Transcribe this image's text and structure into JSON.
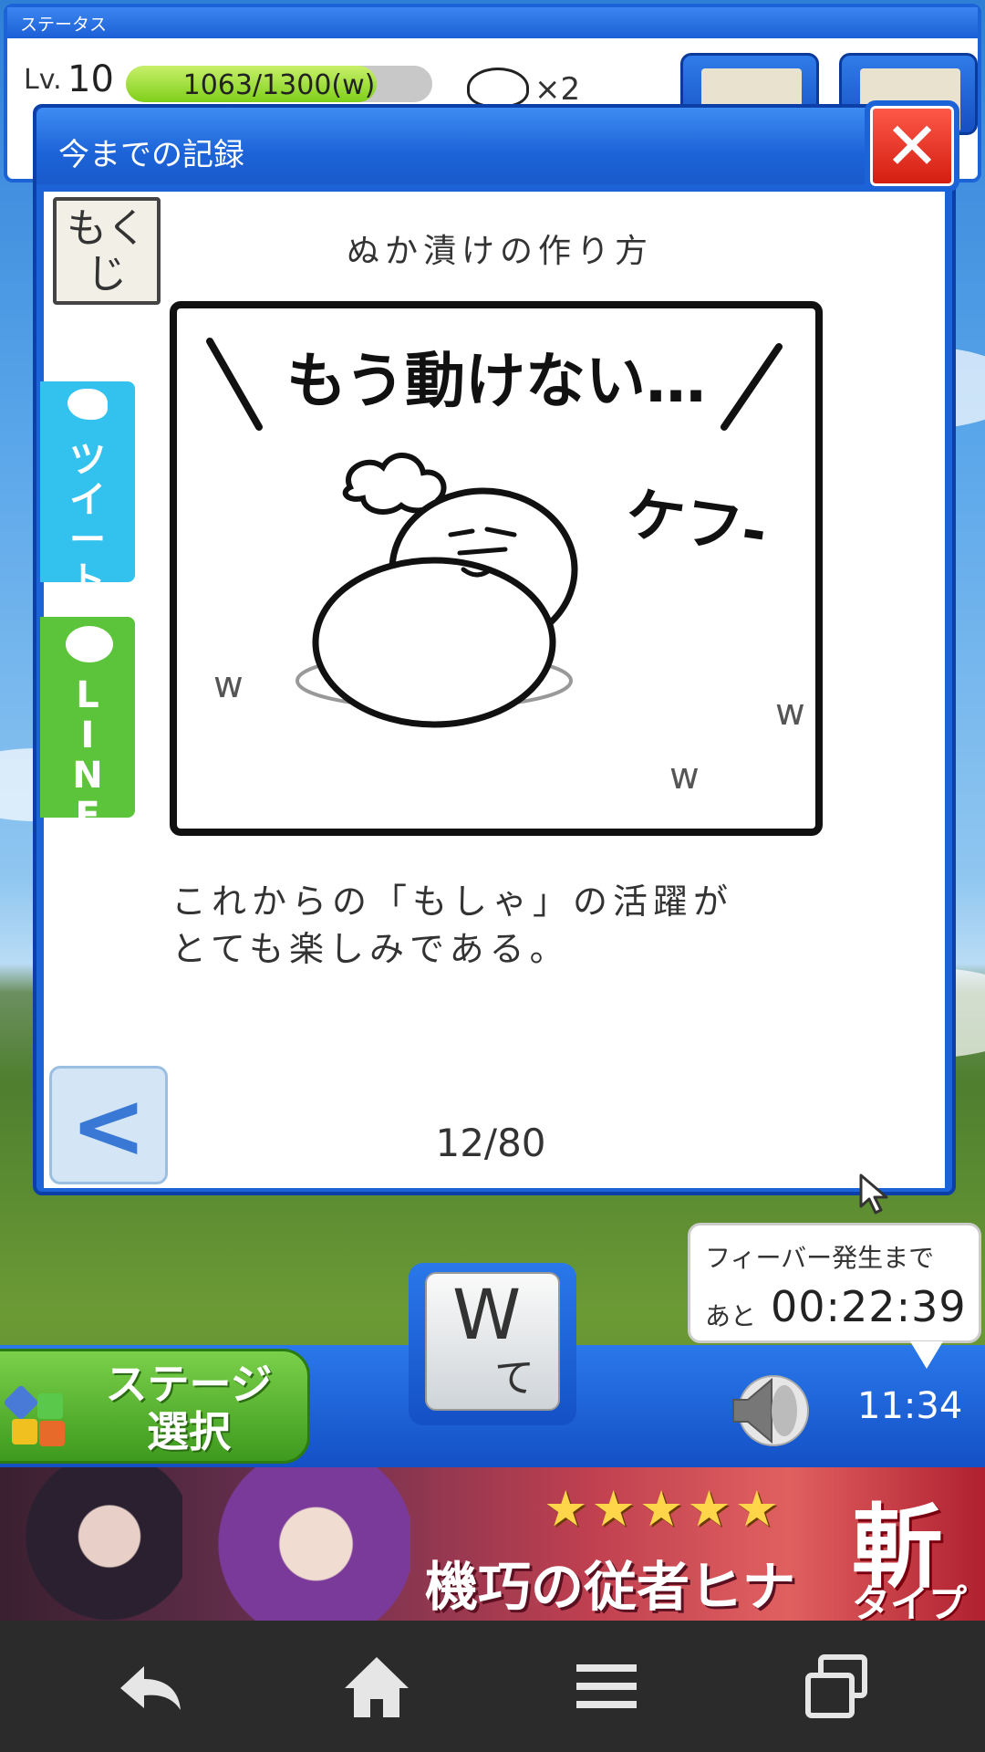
{
  "status_panel": {
    "title": "ステータス",
    "level_label": "Lv.",
    "level": "10",
    "exp_text": "1063/1300(w)",
    "exp_progress": 0.8177,
    "mochi_count": "×2"
  },
  "dialog": {
    "title": "今までの記録",
    "mokuji_label": "もくじ",
    "chapter_title": "ぬか漬けの作り方",
    "tweet_label": "ツイート",
    "line_label": "LINE",
    "comic": {
      "speech": "もう動けない…",
      "sfx": "ケフ-",
      "grass_marks": [
        "w",
        "w",
        "w"
      ]
    },
    "caption_lines": [
      "これからの「もしゃ」の活躍が",
      "とても楽しみである。"
    ],
    "page_counter": "12/80"
  },
  "bottom_bar": {
    "stage_select_label": "ステージ選択",
    "w_key_big": "W",
    "w_key_small": "て",
    "fever_label": "フィーバー発生まで",
    "fever_prefix": "あと",
    "fever_time": "00:22:39",
    "clock": "11:34"
  },
  "ad_banner": {
    "stars": "★★★★★",
    "title": "機巧の従者ヒナ",
    "zan": "斬",
    "type": "タイプ"
  },
  "colors": {
    "dialog_blue": "#1d63d8",
    "close_red": "#e0261a",
    "tweet_blue": "#33c1ee",
    "line_green": "#5cc43a"
  }
}
